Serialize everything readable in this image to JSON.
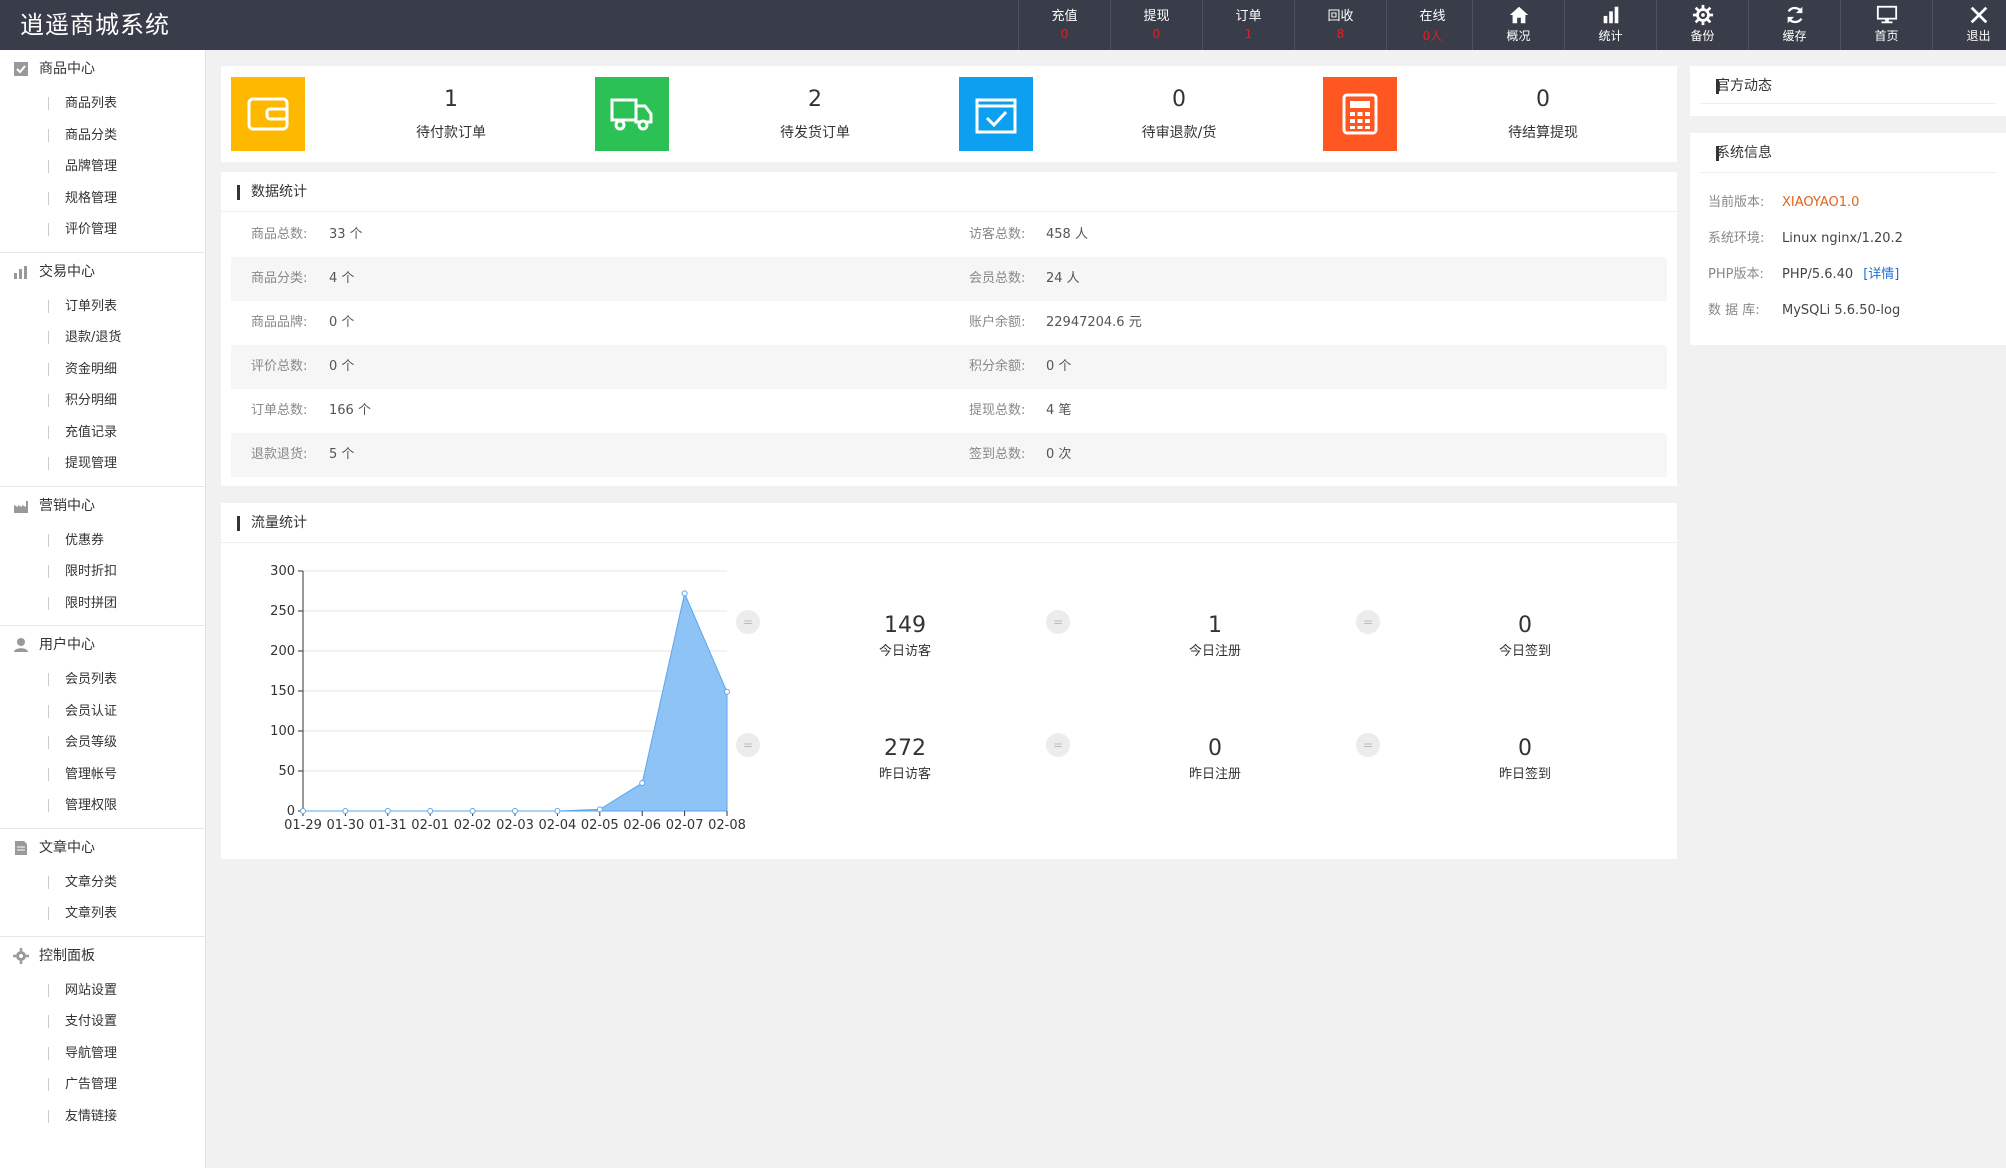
{
  "brand": "逍遥商城系统",
  "header_stats": [
    {
      "label": "充值",
      "value": "0"
    },
    {
      "label": "提现",
      "value": "0"
    },
    {
      "label": "订单",
      "value": "1"
    },
    {
      "label": "回收",
      "value": "8"
    },
    {
      "label": "在线",
      "value": "0人"
    }
  ],
  "header_tools": [
    {
      "label": "概况",
      "icon": "home-icon"
    },
    {
      "label": "统计",
      "icon": "bar-chart-icon"
    },
    {
      "label": "备份",
      "icon": "gear-icon"
    },
    {
      "label": "缓存",
      "icon": "refresh-icon"
    },
    {
      "label": "首页",
      "icon": "monitor-icon"
    },
    {
      "label": "退出",
      "icon": "close-icon"
    }
  ],
  "sidebar": [
    {
      "title": "商品中心",
      "icon": "checkbox-icon",
      "items": [
        "商品列表",
        "商品分类",
        "品牌管理",
        "规格管理",
        "评价管理"
      ]
    },
    {
      "title": "交易中心",
      "icon": "bar-chart-icon",
      "items": [
        "订单列表",
        "退款/退货",
        "资金明细",
        "积分明细",
        "充值记录",
        "提现管理"
      ]
    },
    {
      "title": "营销中心",
      "icon": "factory-icon",
      "items": [
        "优惠券",
        "限时折扣",
        "限时拼团"
      ]
    },
    {
      "title": "用户中心",
      "icon": "user-icon",
      "items": [
        "会员列表",
        "会员认证",
        "会员等级",
        "管理帐号",
        "管理权限"
      ]
    },
    {
      "title": "文章中心",
      "icon": "document-icon",
      "items": [
        "文章分类",
        "文章列表"
      ]
    },
    {
      "title": "控制面板",
      "icon": "gear-icon",
      "items": [
        "网站设置",
        "支付设置",
        "导航管理",
        "广告管理",
        "友情链接"
      ]
    }
  ],
  "cards": [
    {
      "value": "1",
      "label": "待付款订单",
      "color": "#ffb800",
      "icon": "wallet-icon"
    },
    {
      "value": "2",
      "label": "待发货订单",
      "color": "#2bc155",
      "icon": "truck-icon"
    },
    {
      "value": "0",
      "label": "待审退款/货",
      "color": "#0d9ff0",
      "icon": "check-box-icon"
    },
    {
      "value": "0",
      "label": "待结算提现",
      "color": "#ff5722",
      "icon": "calculator-icon"
    }
  ],
  "data_stats": {
    "title": "数据统计",
    "rows": [
      {
        "l1": "商品总数:",
        "v1": "33 个",
        "l2": "访客总数:",
        "v2": "458 人"
      },
      {
        "l1": "商品分类:",
        "v1": "4 个",
        "l2": "会员总数:",
        "v2": "24 人"
      },
      {
        "l1": "商品品牌:",
        "v1": "0 个",
        "l2": "账户余额:",
        "v2": "22947204.6 元"
      },
      {
        "l1": "评价总数:",
        "v1": "0 个",
        "l2": "积分余额:",
        "v2": "0 个"
      },
      {
        "l1": "订单总数:",
        "v1": "166 个",
        "l2": "提现总数:",
        "v2": "4 笔"
      },
      {
        "l1": "退款退货:",
        "v1": "5 个",
        "l2": "签到总数:",
        "v2": "0 次"
      }
    ]
  },
  "flow": {
    "title": "流量统计",
    "eq_symbol": "=",
    "metrics": [
      {
        "value": "149",
        "label": "今日访客"
      },
      {
        "value": "1",
        "label": "今日注册"
      },
      {
        "value": "0",
        "label": "今日签到"
      },
      {
        "value": "272",
        "label": "昨日访客"
      },
      {
        "value": "0",
        "label": "昨日注册"
      },
      {
        "value": "0",
        "label": "昨日签到"
      }
    ]
  },
  "chart_data": {
    "type": "area",
    "x": [
      "01-29",
      "01-30",
      "01-31",
      "02-01",
      "02-02",
      "02-03",
      "02-04",
      "02-05",
      "02-06",
      "02-07",
      "02-08"
    ],
    "y_ticks": [
      "300",
      "250",
      "200",
      "150",
      "100",
      "50",
      "0"
    ],
    "ylim": [
      0,
      300
    ],
    "series": [
      {
        "values": [
          0,
          0,
          0,
          0,
          0,
          0,
          0,
          2,
          35,
          272,
          149
        ]
      }
    ],
    "color": "#7ab8f5",
    "grid": true
  },
  "news": {
    "title": "官方动态"
  },
  "sysinfo": {
    "title": "系统信息",
    "rows": [
      {
        "label": "当前版本:",
        "value": "XIAOYAO1.0"
      },
      {
        "label": "系统环境:",
        "value": "Linux nginx/1.20.2"
      },
      {
        "label": "PHP版本:",
        "value": "PHP/5.6.40",
        "link": "[详情]"
      },
      {
        "label": "数 据 库:",
        "value": "MySQLi 5.6.50-log"
      }
    ]
  }
}
